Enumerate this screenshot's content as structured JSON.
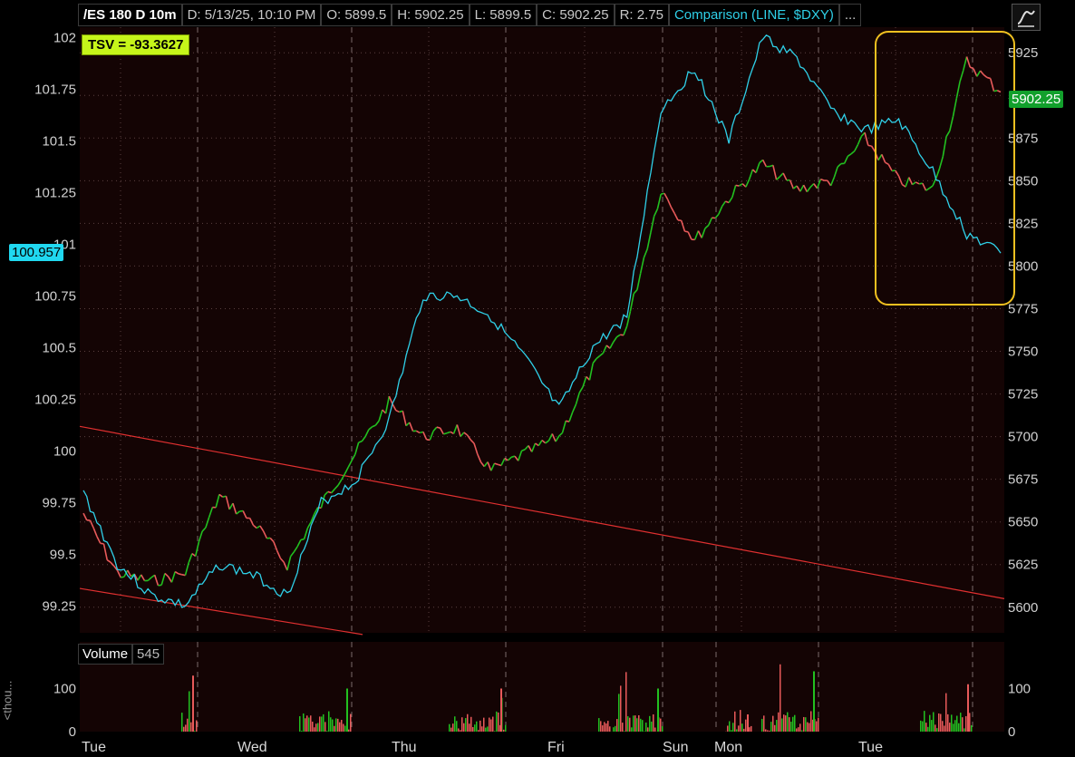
{
  "header": {
    "symbol": "/ES 180 D 10m",
    "date": "D: 5/13/25, 10:10 PM",
    "open": "O: 5899.5",
    "high": "H: 5902.25",
    "low": "L: 5899.5",
    "close": "C: 5902.25",
    "range": "R: 2.75",
    "comparison": "Comparison (LINE, $DXY)",
    "more": "..."
  },
  "study_button": {
    "icon": "style-icon"
  },
  "tsv_label": "TSV  = -93.3627",
  "last_price_badge": "5902.25",
  "comparison_badge": "100.957",
  "volume_panel": {
    "name": "Volume",
    "value": "545",
    "axis_label": "<thou..."
  },
  "colors": {
    "background": "#140404",
    "up": "#22c020",
    "down": "#e85a5a",
    "comparison": "#2fd0e8",
    "trendline": "#e03030",
    "highlight": "#f0c020",
    "tsv_bg": "#c6f51a"
  },
  "chart_data": [
    {
      "type": "line",
      "title": "/ES 180 D 10m",
      "price_axis_right": {
        "ylim": [
          5585,
          5940
        ],
        "ticks": [
          "5925",
          "5900",
          "5875",
          "5850",
          "5825",
          "5800",
          "5775",
          "5750",
          "5725",
          "5700",
          "5675",
          "5650",
          "5625",
          "5600"
        ]
      },
      "comparison_axis_left": {
        "ylim": [
          99.12,
          102.05
        ],
        "ticks": [
          "102",
          "101.75",
          "101.5",
          "101.25",
          "101",
          "100.75",
          "100.5",
          "100.25",
          "100",
          "99.75",
          "99.5",
          "99.25"
        ]
      },
      "x_labels": [
        "Tue",
        "Wed",
        "Thu",
        "Fri",
        "Sun",
        "Mon",
        "Tue"
      ],
      "series": [
        {
          "name": "/ES",
          "x": [
            "Tue",
            "",
            "",
            "",
            "Wed",
            "",
            "",
            "",
            "Thu",
            "",
            "",
            "",
            "Fri",
            "",
            "",
            "Sun",
            "",
            "",
            "",
            "Mon",
            "",
            "",
            "",
            "",
            "Tue",
            "",
            "",
            ""
          ],
          "values": [
            5655,
            5620,
            5615,
            5620,
            5665,
            5650,
            5625,
            5660,
            5690,
            5720,
            5700,
            5705,
            5680,
            5690,
            5700,
            5740,
            5765,
            5845,
            5815,
            5840,
            5860,
            5845,
            5850,
            5875,
            5850,
            5845,
            5920,
            5902
          ]
        },
        {
          "name": "$DXY",
          "x": [
            "Tue",
            "",
            "",
            "",
            "Wed",
            "",
            "",
            "",
            "Thu",
            "",
            "",
            "",
            "Fri",
            "",
            "",
            "Sun",
            "",
            "",
            "",
            "Mon",
            "",
            "",
            "",
            "",
            "Tue",
            "",
            "",
            ""
          ],
          "values": [
            99.8,
            99.45,
            99.3,
            99.25,
            99.45,
            99.4,
            99.3,
            99.75,
            99.85,
            100.15,
            100.75,
            100.75,
            100.65,
            100.45,
            100.2,
            100.5,
            100.65,
            101.65,
            101.85,
            101.5,
            102.0,
            101.9,
            101.65,
            101.55,
            101.6,
            101.35,
            101.05,
            100.957
          ]
        }
      ],
      "annotations": [
        "descending trendline channel",
        "highlight box"
      ]
    },
    {
      "type": "bar",
      "title": "Volume",
      "ylim": [
        0,
        150
      ],
      "ticks": [
        "100",
        "0"
      ],
      "categories": [
        "Tue",
        "Wed",
        "Thu",
        "Fri",
        "Sun",
        "Mon",
        "Tue"
      ],
      "values": [
        130,
        100,
        100,
        100,
        40,
        140,
        110
      ]
    }
  ]
}
